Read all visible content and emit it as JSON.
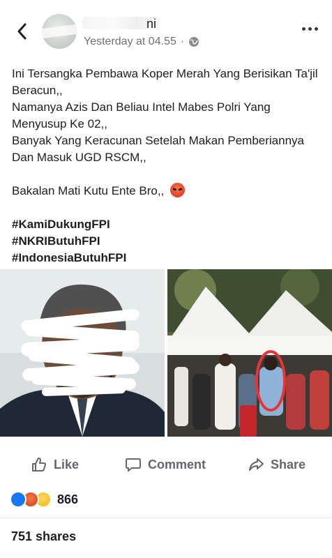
{
  "header": {
    "author_name": "ni",
    "timestamp": "Yesterday at 04.55",
    "separator": "·",
    "privacy_icon": "globe-icon",
    "back_icon": "chevron-left-icon",
    "more_icon": "more-horizontal-icon"
  },
  "post": {
    "lines": [
      "Ini Tersangka Pembawa Koper Merah Yang Berisikan Ta'jil Beracun,,",
      "Namanya Azis Dan Beliau Intel Mabes Polri Yang Menyusup Ke 02,,",
      "Banyak Yang Keracunan Setelah Makan Pemberiannya Dan Masuk UGD RSCM,,"
    ],
    "closing": "Bakalan Mati Kutu Ente Bro,,",
    "closing_emoji": "angry-face-icon",
    "hashtags": [
      "#KamiDukungFPI",
      "#NKRIButuhFPI",
      "#IndonesiaButuhFPI"
    ]
  },
  "photos": {
    "left_photo": "portrait-photo-obscured",
    "right_photo": "crowd-under-tents-photo-highlighted"
  },
  "actions": {
    "like_label": "Like",
    "comment_label": "Comment",
    "share_label": "Share"
  },
  "stats": {
    "reaction_count": "866",
    "reaction_icons": [
      "like-icon",
      "angry-icon",
      "wow-icon"
    ],
    "shares": "751 shares"
  },
  "colors": {
    "text": "#1c1e21",
    "secondary": "#65676b",
    "meta": "#717171",
    "facebook_blue": "#1877f2",
    "highlight_circle": "#e8333a"
  }
}
